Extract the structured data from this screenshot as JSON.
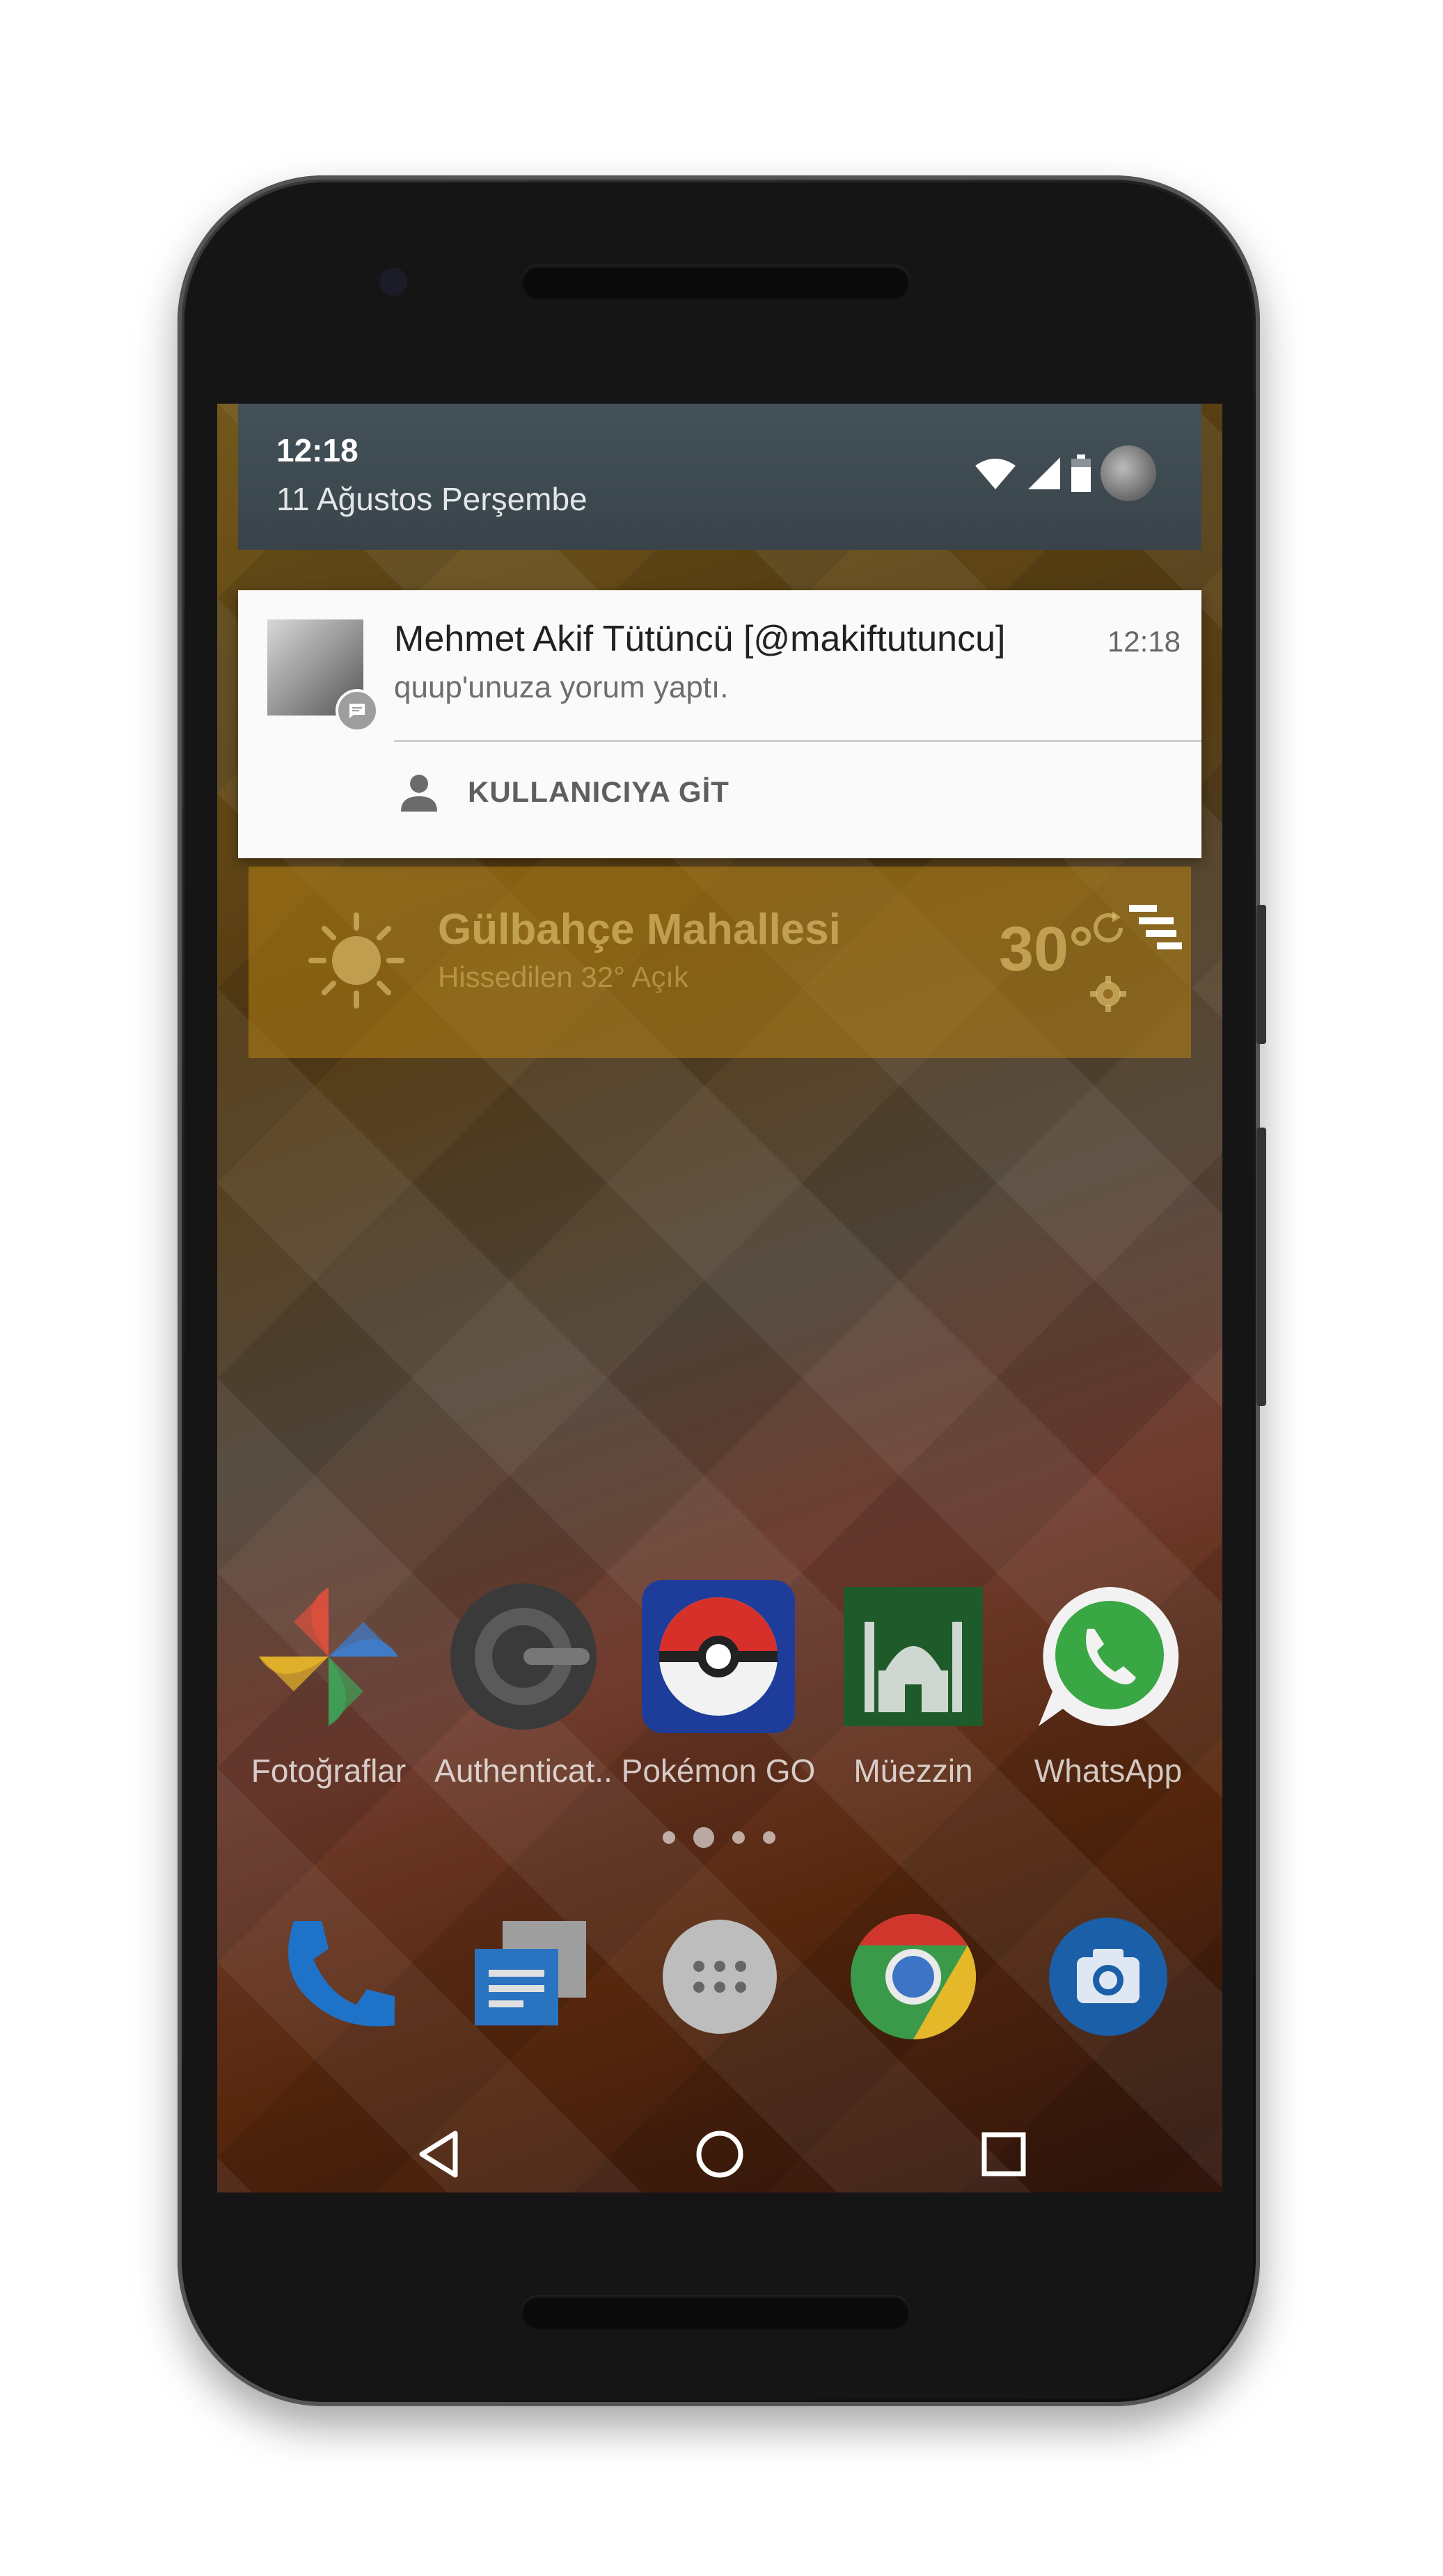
{
  "statusbar": {
    "time": "12:18",
    "date": "11 Ağustos Perşembe",
    "icons": [
      "wifi-icon",
      "signal-icon",
      "battery-icon",
      "user-avatar"
    ]
  },
  "notification": {
    "title": "Mehmet Akif Tütüncü [@makiftutuncu]",
    "time": "12:18",
    "text": "quup'unuza yorum yaptı.",
    "action_label": "KULLANICIYA GİT",
    "action_icon": "person-icon",
    "badge_icon": "message-icon"
  },
  "weather": {
    "place": "Gülbahçe Mahallesi",
    "subtitle": "Hissedilen 32° Açık",
    "temp": "30°",
    "icons": [
      "sun-icon",
      "refresh-icon",
      "settings-icon"
    ]
  },
  "apps": [
    {
      "label": "Fotoğraflar",
      "icon": "photos-icon"
    },
    {
      "label": "Authenticat..",
      "icon": "authenticator-icon"
    },
    {
      "label": "Pokémon GO",
      "icon": "pokeball-icon"
    },
    {
      "label": "Müezzin",
      "icon": "mosque-icon"
    },
    {
      "label": "WhatsApp",
      "icon": "whatsapp-icon"
    }
  ],
  "dock": [
    "phone-icon",
    "messenger-icon",
    "app-drawer-icon",
    "chrome-icon",
    "camera-icon"
  ],
  "nav": [
    "back-icon",
    "home-icon",
    "recents-icon"
  ],
  "colors": {
    "statusbar_bg": "#3d4a52",
    "notification_bg": "#fafafa",
    "weather_bg": "#b48214"
  }
}
